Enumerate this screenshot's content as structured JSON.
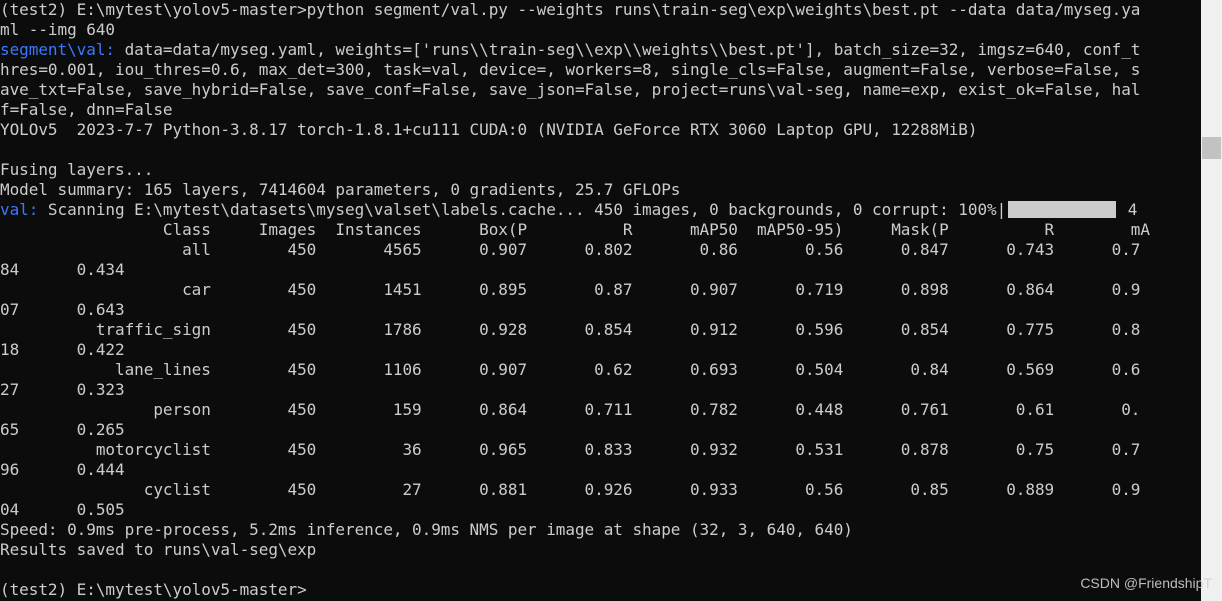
{
  "terminal": {
    "command_line": "(test2) E:\\mytest\\yolov5-master>python segment/val.py --weights runs\\train-seg\\exp\\weights\\best.pt --data data/myseg.ya",
    "command_wrap": "ml --img 640",
    "args_prefix": "segment\\val:",
    "args_line_1": " data=data/myseg.yaml, weights=['runs\\\\train-seg\\\\exp\\\\weights\\\\best.pt'], batch_size=32, imgsz=640, conf_t",
    "args_line_2": "hres=0.001, iou_thres=0.6, max_det=300, task=val, device=, workers=8, single_cls=False, augment=False, verbose=False, s",
    "args_line_3": "ave_txt=False, save_hybrid=False, save_conf=False, save_json=False, project=runs\\val-seg, name=exp, exist_ok=False, hal",
    "args_line_4": "f=False, dnn=False",
    "env_line": "YOLOv5  2023-7-7 Python-3.8.17 torch-1.8.1+cu111 CUDA:0 (NVIDIA GeForce RTX 3060 Laptop GPU, 12288MiB)",
    "fusing": "Fusing layers...",
    "model_summary": "Model summary: 165 layers, 7414604 parameters, 0 gradients, 25.7 GFLOPs",
    "scan_prefix": "val:",
    "scan_text": " Scanning E:\\mytest\\datasets\\myseg\\valset\\labels.cache... 450 images, 0 backgrounds, 0 corrupt: 100%|",
    "scan_progress": 1.0,
    "scan_tail": " 4",
    "header_line": "                 Class     Images  Instances      Box(P          R      mAP50  mAP50-95)     Mask(P          R        mA",
    "rows": [
      {
        "main": "                   all        450       4565      0.907      0.802       0.86       0.56      0.847      0.743      0.7",
        "wrap": "84      0.434"
      },
      {
        "main": "                   car        450       1451      0.895       0.87      0.907      0.719      0.898      0.864      0.9",
        "wrap": "07      0.643"
      },
      {
        "main": "          traffic_sign        450       1786      0.928      0.854      0.912      0.596      0.854      0.775      0.8",
        "wrap": "18      0.422"
      },
      {
        "main": "            lane_lines        450       1106      0.907       0.62      0.693      0.504       0.84      0.569      0.6",
        "wrap": "27      0.323"
      },
      {
        "main": "                person        450        159      0.864      0.711      0.782      0.448      0.761       0.61       0.",
        "wrap": "65      0.265"
      },
      {
        "main": "          motorcyclist        450         36      0.965      0.833      0.932      0.531      0.878       0.75      0.7",
        "wrap": "96      0.444"
      },
      {
        "main": "               cyclist        450         27      0.881      0.926      0.933       0.56       0.85      0.889      0.9",
        "wrap": "04      0.505"
      }
    ],
    "speed_line": "Speed: 0.9ms pre-process, 5.2ms inference, 0.9ms NMS per image at shape (32, 3, 640, 640)",
    "results_line": "Results saved to runs\\val-seg\\exp",
    "prompt_line": "(test2) E:\\mytest\\yolov5-master>"
  },
  "watermark": "CSDN @FriendshipT",
  "colors": {
    "background": "#0c0c0c",
    "text": "#cccccc",
    "accent_blue": "#3b78ff"
  }
}
